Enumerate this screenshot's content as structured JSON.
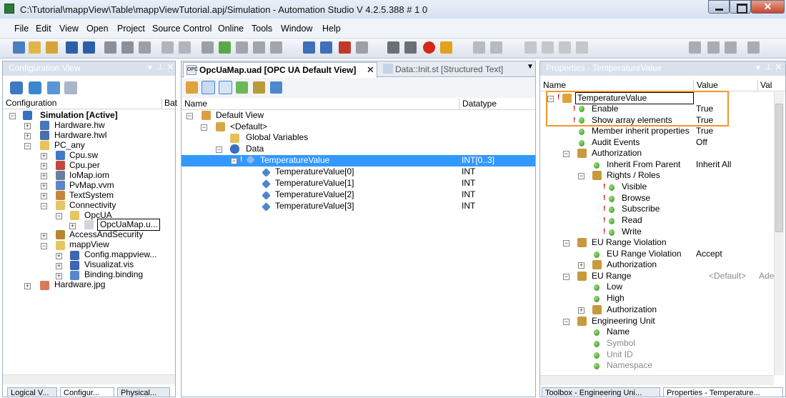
{
  "window": {
    "title": "C:\\Tutorial\\mappView\\Table\\mappViewTutorial.apj/Simulation - Automation Studio V 4.2.5.388 # 1 0",
    "close": "✕"
  },
  "menu": [
    "File",
    "Edit",
    "View",
    "Open",
    "Project",
    "Source Control",
    "Online",
    "Tools",
    "Window",
    "Help"
  ],
  "config_view": {
    "title": "Configuration View",
    "col_config": "Configuration",
    "col_bat": "Bat",
    "items": [
      "Simulation [Active]",
      "Hardware.hw",
      "Hardware.hwl",
      "PC_any",
      "Cpu.sw",
      "Cpu.per",
      "IoMap.iom",
      "PvMap.vvm",
      "TextSystem",
      "Connectivity",
      "OpcUA",
      "OpcUaMap.u...",
      "AccessAndSecurity",
      "mappView",
      "Config.mappview...",
      "Visualizat.vis",
      "Binding.binding",
      "Hardware.jpg"
    ],
    "bottom_tabs": [
      "Logical V...",
      "Configur...",
      "Physical..."
    ]
  },
  "editor": {
    "tab_active": "OpcUaMap.uad [OPC UA Default View]",
    "tab_other": "Data::Init.st [Structured Text]",
    "col_name": "Name",
    "col_datatype": "Datatype",
    "rows": [
      {
        "name": "Default View",
        "type": ""
      },
      {
        "name": "<Default>",
        "type": ""
      },
      {
        "name": "Global Variables",
        "type": ""
      },
      {
        "name": "Data",
        "type": ""
      },
      {
        "name": "TemperatureValue",
        "type": "INT[0..3]"
      },
      {
        "name": "TemperatureValue[0]",
        "type": "INT"
      },
      {
        "name": "TemperatureValue[1]",
        "type": "INT"
      },
      {
        "name": "TemperatureValue[2]",
        "type": "INT"
      },
      {
        "name": "TemperatureValue[3]",
        "type": "INT"
      }
    ]
  },
  "properties": {
    "title": "Properties - TemperatureValue",
    "col_name": "Name",
    "col_value": "Value",
    "col_val2": "Val",
    "rows": [
      {
        "name": "TemperatureValue",
        "value": ""
      },
      {
        "name": "Enable",
        "value": "True"
      },
      {
        "name": "Show array elements",
        "value": "True"
      },
      {
        "name": "Member inherit properties",
        "value": "True"
      },
      {
        "name": "Audit Events",
        "value": "Off"
      },
      {
        "name": "Authorization",
        "value": ""
      },
      {
        "name": "Inherit From Parent",
        "value": "Inherit All"
      },
      {
        "name": "Rights / Roles",
        "value": ""
      },
      {
        "name": "Visible",
        "value": ""
      },
      {
        "name": "Browse",
        "value": ""
      },
      {
        "name": "Subscribe",
        "value": ""
      },
      {
        "name": "Read",
        "value": ""
      },
      {
        "name": "Write",
        "value": ""
      },
      {
        "name": "EU Range Violation",
        "value": ""
      },
      {
        "name": "EU Range Violation",
        "value": "Accept"
      },
      {
        "name": "Authorization",
        "value": ""
      },
      {
        "name": "EU Range",
        "value": "<Default>"
      },
      {
        "name": "Low",
        "value": ""
      },
      {
        "name": "High",
        "value": ""
      },
      {
        "name": "Authorization",
        "value": ""
      },
      {
        "name": "Engineering Unit",
        "value": ""
      },
      {
        "name": "Name",
        "value": ""
      },
      {
        "name": "Symbol",
        "value": ""
      },
      {
        "name": "Unit ID",
        "value": ""
      },
      {
        "name": "Namespace",
        "value": ""
      }
    ],
    "extra_ade": "Ade",
    "bottom_tabs": [
      "Toolbox - Engineering Uni...",
      "Properties - Temperature..."
    ]
  },
  "colors": {
    "accent": "#3399ff",
    "highlight": "#f0962c"
  }
}
